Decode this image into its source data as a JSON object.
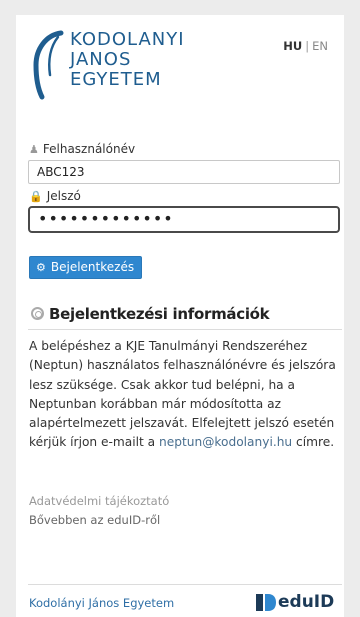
{
  "header": {
    "logo_lines": [
      "KODOLANYI",
      "JANOS",
      "EGYETEM"
    ],
    "lang": {
      "hu": "HU",
      "separator": "|",
      "en": "EN"
    }
  },
  "form": {
    "username_label": "Felhasználónév",
    "username_value": "ABC123",
    "password_label": "Jelszó",
    "password_value": "•••••••••••••",
    "login_button": "Bejelentkezés"
  },
  "info": {
    "title": "Bejelentkezési információk",
    "text_before_email": "A belépéshez a KJE Tanulmányi Rendszeréhez (Neptun) használatos felhasználónévre és jelszóra lesz szüksége. Csak akkor tud belépni, ha a Neptunban korábban már módosította az alapértelmezett jelszavát. Elfelejtett jelszó esetén kérjük írjon e-mailt a ",
    "email": "neptun@kodolanyi.hu",
    "text_after_email": " címre."
  },
  "links": {
    "privacy": "Adatvédelmi tájékoztató",
    "eduid_more": "Bővebben az eduID-ről"
  },
  "footer": {
    "university": "Kodolányi János Egyetem",
    "eduid_logo": "eduID"
  },
  "icons": {
    "user": "user-icon",
    "lock": "lock-icon",
    "gear": "gear-icon",
    "lifebuoy": "lifebuoy-icon"
  },
  "colors": {
    "brand_blue": "#1f5d8f",
    "button_blue": "#2f87cf",
    "link_blue": "#2f6fa6",
    "eduid_navy": "#1c3a57"
  }
}
